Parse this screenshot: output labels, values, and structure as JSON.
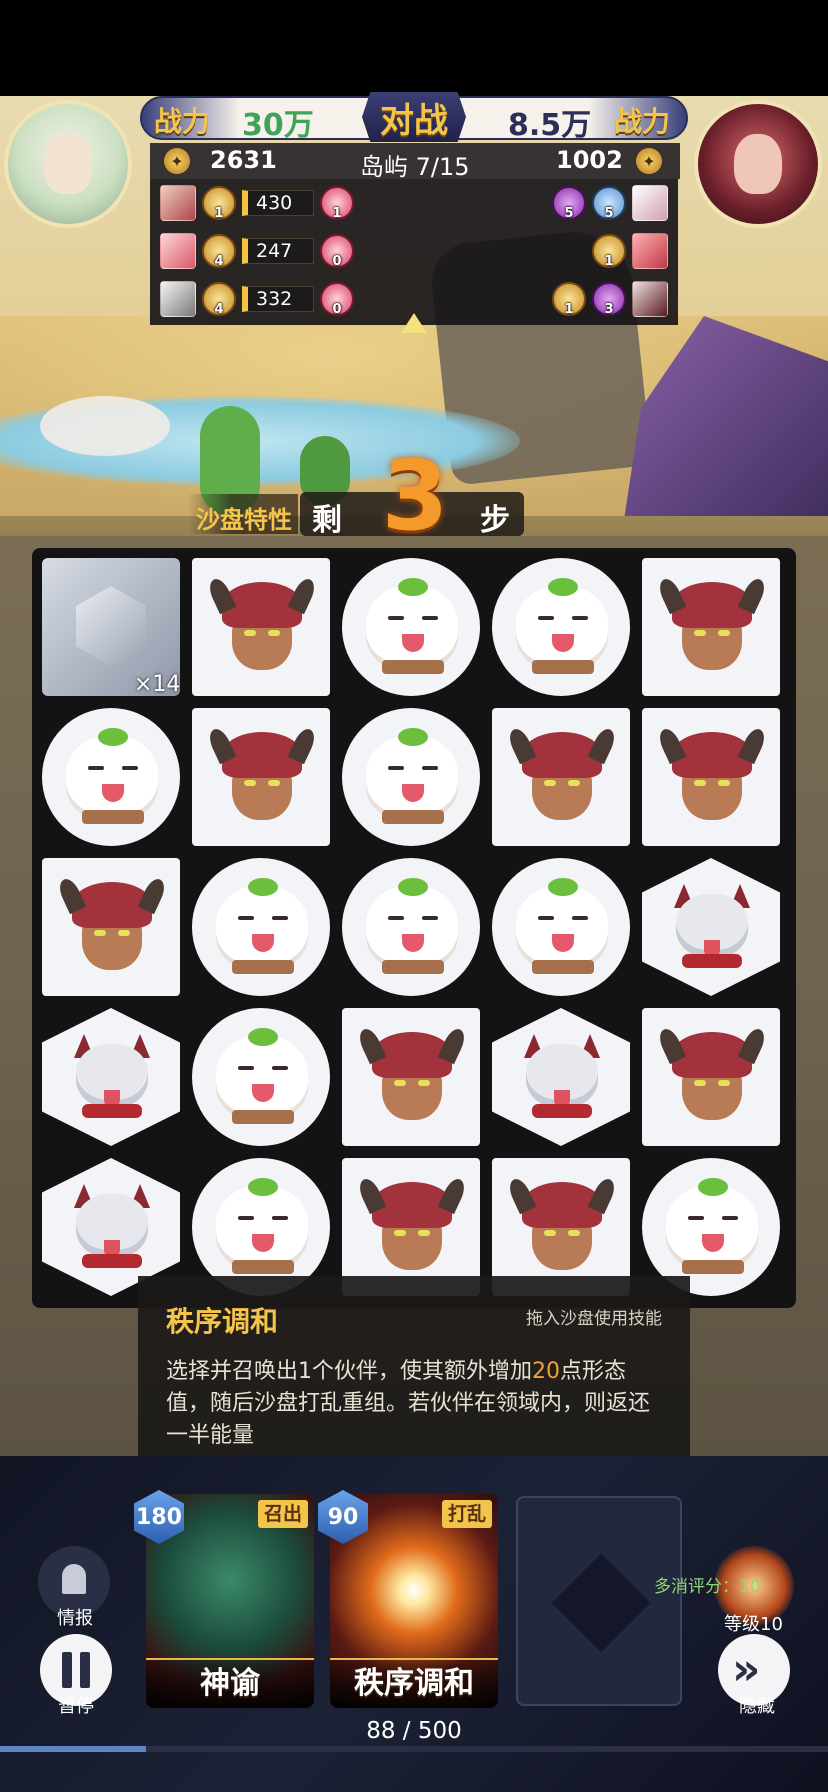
{
  "header": {
    "left_power_label": "战力",
    "left_power_value": "30万",
    "vs_label": "对战",
    "right_power_value": "8.5万",
    "right_power_label": "战力",
    "left_score": "2631",
    "stage": "岛屿 7/15",
    "right_score": "1002"
  },
  "roster": {
    "left": [
      {
        "count": "1",
        "hp": "430",
        "extra": "1"
      },
      {
        "count": "4",
        "hp": "247",
        "extra": "0"
      },
      {
        "count": "4",
        "hp": "332",
        "extra": "0"
      }
    ],
    "right": [
      {
        "coins": [
          "5",
          "5"
        ]
      },
      {
        "coins": [
          "1"
        ]
      },
      {
        "coins": [
          "1",
          "3"
        ]
      }
    ]
  },
  "steps": {
    "sandbox_trait_label": "沙盘特性",
    "prefix": "剩",
    "count": "3",
    "suffix": "步"
  },
  "board": {
    "block_count": "×14",
    "rows": [
      [
        "block",
        "demon",
        "dog",
        "dog",
        "demon"
      ],
      [
        "dog",
        "demon",
        "dog",
        "demon",
        "demon"
      ],
      [
        "demon",
        "dog",
        "dog",
        "dog",
        "wolf"
      ],
      [
        "wolf",
        "dog",
        "demon",
        "wolf",
        "demon"
      ],
      [
        "wolf",
        "dog",
        "demon",
        "demon",
        "dog"
      ]
    ]
  },
  "skill_tooltip": {
    "title": "秩序调和",
    "hint": "拖入沙盘使用技能",
    "desc_part1": "选择并召唤出1个伙伴，使其额外增加",
    "desc_highlight": "20",
    "desc_part2": "点形态值，随后沙盘打乱重组。若伙伴在领域内，则返还一半能量"
  },
  "cards": [
    {
      "name": "神谕",
      "cost": "180",
      "tag": "召出"
    },
    {
      "name": "秩序调和",
      "cost": "90",
      "tag": "打乱"
    }
  ],
  "controls": {
    "info_label": "情报",
    "pause_label": "暂停",
    "hide_label": "隐藏",
    "combo_label": "多消评分：10",
    "level_label": "等级10"
  },
  "progress": {
    "text": "88 / 500",
    "fraction": 0.176
  },
  "colors": {
    "accent_gold": "#f4c54a",
    "highlight_orange": "#f2a23a",
    "power_green": "#3fa45a",
    "progress_blue": "#5d86c9"
  }
}
